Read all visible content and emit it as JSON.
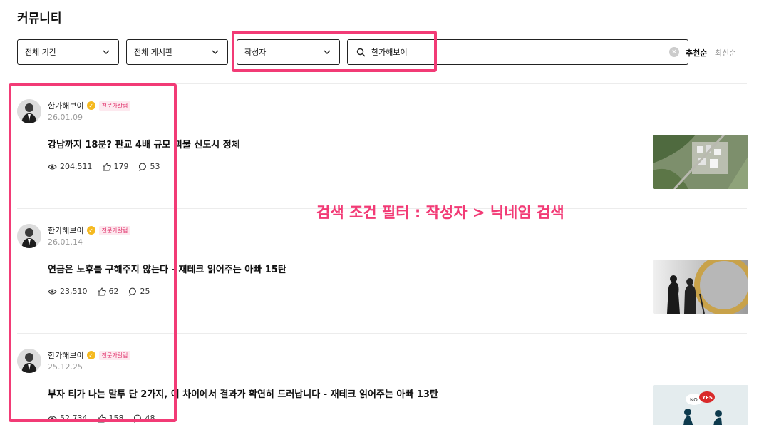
{
  "page": {
    "title": "커뮤니티"
  },
  "filters": {
    "period": "전체 기간",
    "board": "전체 게시판",
    "search_type": "작성자",
    "search_value": "한가해보이"
  },
  "sort": {
    "active": "추천순",
    "inactive": "최신순"
  },
  "annotation": "검색 조건 필터 : 작성자 > 닉네임 검색",
  "colors": {
    "accent": "#f23b76",
    "badge": "#f5b920",
    "expert_text": "#e0306a"
  },
  "posts": [
    {
      "author": "한가해보이",
      "badge": "전문가칼럼",
      "date": "26.01.09",
      "title": "강남까지 18분? 판교 4배 규모 괴물 신도시 정체",
      "views": "204,511",
      "likes": "179",
      "comments": "53",
      "thumb_icon": "aerial-city-photo"
    },
    {
      "author": "한가해보이",
      "badge": "전문가칼럼",
      "date": "26.01.14",
      "title": "연금은 노후를 구해주지 않는다 - 재테크 읽어주는 아빠 15탄",
      "views": "23,510",
      "likes": "62",
      "comments": "25",
      "thumb_icon": "elderly-couple-coin-photo"
    },
    {
      "author": "한가해보이",
      "badge": "전문가칼럼",
      "date": "25.12.25",
      "title": "부자 티가 나는 말투 단 2가지, 이 차이에서 결과가 확연히 드러납니다 - 재테크 읽어주는 아빠 13탄",
      "views": "52,734",
      "likes": "158",
      "comments": "48",
      "thumb_icon": "no-yes-illustration"
    }
  ]
}
